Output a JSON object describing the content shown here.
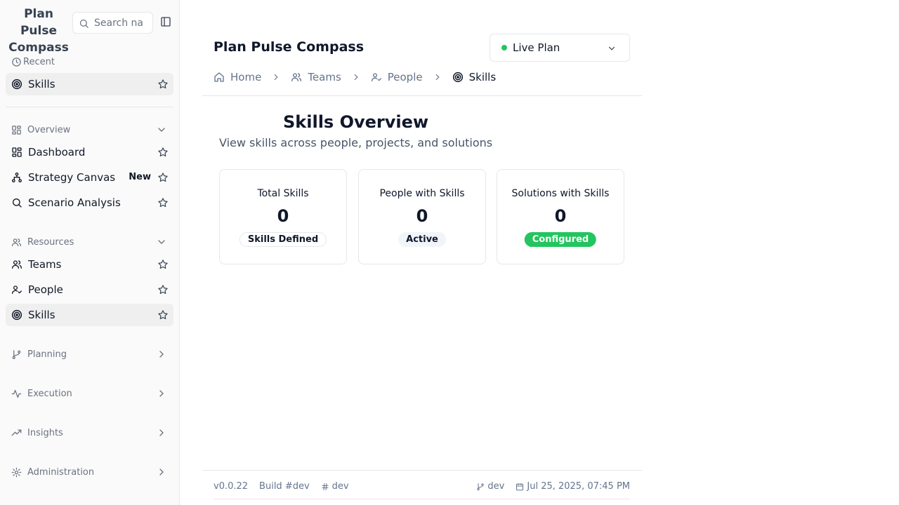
{
  "app": {
    "title": "Plan Pulse Compass",
    "brand_line1": "Plan Pulse",
    "brand_line2": "Compass"
  },
  "search": {
    "placeholder": "Search na"
  },
  "sidebar": {
    "recent_label": "Recent",
    "recent_items": [
      {
        "label": "Skills",
        "icon": "target-icon",
        "active": true
      }
    ],
    "overview": {
      "label": "Overview",
      "items": [
        {
          "label": "Dashboard",
          "icon": "dashboard-icon"
        },
        {
          "label": "Strategy Canvas",
          "icon": "workflow-icon",
          "badge": "New"
        },
        {
          "label": "Scenario Analysis",
          "icon": "search-icon"
        }
      ]
    },
    "resources": {
      "label": "Resources",
      "items": [
        {
          "label": "Teams",
          "icon": "users-icon"
        },
        {
          "label": "People",
          "icon": "user-check-icon"
        },
        {
          "label": "Skills",
          "icon": "target-icon",
          "active": true
        }
      ]
    },
    "collapsed_groups": [
      {
        "label": "Planning",
        "icon": "git-branch-icon"
      },
      {
        "label": "Execution",
        "icon": "activity-icon"
      },
      {
        "label": "Insights",
        "icon": "trending-up-icon"
      },
      {
        "label": "Administration",
        "icon": "gear-icon"
      }
    ]
  },
  "plan_select": {
    "value": "Live Plan",
    "status_color": "#22c55e"
  },
  "breadcrumb": [
    {
      "label": "Home",
      "icon": "home-icon"
    },
    {
      "label": "Teams",
      "icon": "users-icon"
    },
    {
      "label": "People",
      "icon": "user-check-icon"
    },
    {
      "label": "Skills",
      "icon": "target-icon"
    }
  ],
  "page": {
    "title": "Skills Overview",
    "subtitle": "View skills across people, projects, and solutions"
  },
  "stats": [
    {
      "label": "Total Skills",
      "value": "0",
      "badge": "Skills Defined"
    },
    {
      "label": "People with Skills",
      "value": "0",
      "badge": "Active"
    },
    {
      "label": "Solutions with Skills",
      "value": "0",
      "badge": "Configured",
      "badge_color": "#22c55e"
    }
  ],
  "footer": {
    "version": "v0.0.22",
    "build": "Build #dev",
    "commit": "dev",
    "branch": "dev",
    "date": "Jul 25, 2025, 07:45 PM"
  }
}
